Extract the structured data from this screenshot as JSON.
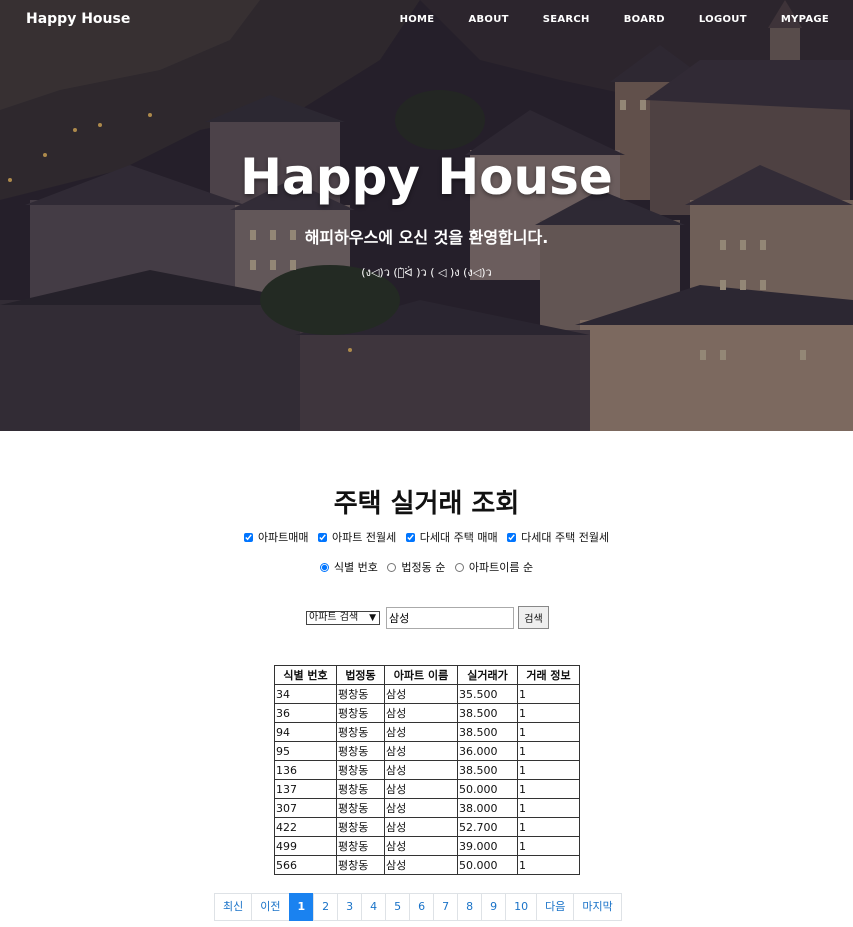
{
  "nav": {
    "brand": "Happy House",
    "links": [
      "HOME",
      "ABOUT",
      "SEARCH",
      "BOARD",
      "LOGOUT",
      "MYPAGE"
    ]
  },
  "hero": {
    "title": "Happy House",
    "subtitle": "해피하우스에 오신 것을 환영합니다.",
    "emoticons": "(ง◁)ว (ง̀ᐛ )ว ( ◁ )ง (ง◁)ว"
  },
  "main": {
    "title": "주택 실거래 조회",
    "filters": [
      {
        "label": "아파트매매",
        "checked": true
      },
      {
        "label": "아파트 전월세",
        "checked": true
      },
      {
        "label": "다세대 주택 매매",
        "checked": true
      },
      {
        "label": "다세대 주택 전월세",
        "checked": true
      }
    ],
    "sort_options": [
      {
        "label": "식별 번호",
        "selected": true
      },
      {
        "label": "법정동 순",
        "selected": false
      },
      {
        "label": "아파트이름 순",
        "selected": false
      }
    ],
    "search": {
      "select_value": "아파트 검색",
      "input_value": "삼성",
      "button_label": "검색"
    },
    "table": {
      "headers": [
        "식별 번호",
        "법정동",
        "아파트 이름",
        "실거래가",
        "거래 정보"
      ],
      "rows": [
        [
          "34",
          "평창동",
          "삼성",
          "35.500",
          "1"
        ],
        [
          "36",
          "평창동",
          "삼성",
          "38.500",
          "1"
        ],
        [
          "94",
          "평창동",
          "삼성",
          "38.500",
          "1"
        ],
        [
          "95",
          "평창동",
          "삼성",
          "36.000",
          "1"
        ],
        [
          "136",
          "평창동",
          "삼성",
          "38.500",
          "1"
        ],
        [
          "137",
          "평창동",
          "삼성",
          "50.000",
          "1"
        ],
        [
          "307",
          "평창동",
          "삼성",
          "38.000",
          "1"
        ],
        [
          "422",
          "평창동",
          "삼성",
          "52.700",
          "1"
        ],
        [
          "499",
          "평창동",
          "삼성",
          "39.000",
          "1"
        ],
        [
          "566",
          "평창동",
          "삼성",
          "50.000",
          "1"
        ]
      ]
    },
    "pagination": {
      "items": [
        "최신",
        "이전",
        "1",
        "2",
        "3",
        "4",
        "5",
        "6",
        "7",
        "8",
        "9",
        "10",
        "다음",
        "마지막"
      ],
      "active": "1"
    }
  },
  "colors": {
    "accent": "#1a82f0",
    "link": "#1a73c8"
  }
}
